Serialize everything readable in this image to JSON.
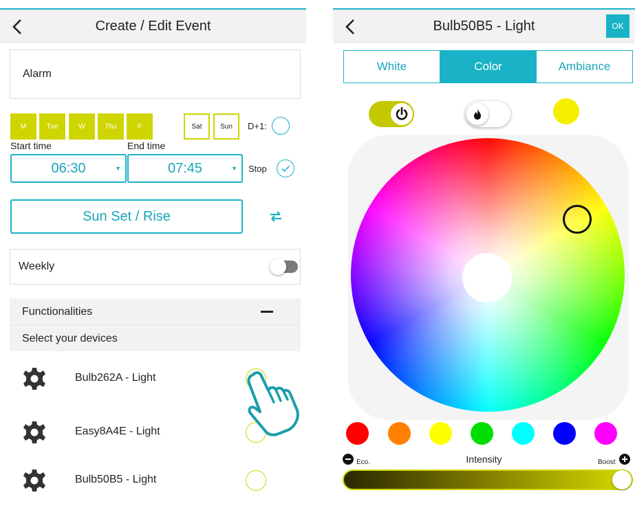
{
  "left": {
    "header": {
      "title": "Create / Edit Event"
    },
    "event_name": "Alarm",
    "days": [
      {
        "label": "M",
        "selected": true
      },
      {
        "label": "Tue",
        "selected": true
      },
      {
        "label": "W",
        "selected": true
      },
      {
        "label": "Thu",
        "selected": true
      },
      {
        "label": "F",
        "selected": true
      },
      {
        "label": "Sat",
        "selected": false
      },
      {
        "label": "Sun",
        "selected": false
      }
    ],
    "d1_label": "D+1:",
    "start_time": {
      "label": "Start time",
      "value": "06:30"
    },
    "end_time": {
      "label": "End time",
      "value": "07:45"
    },
    "stop_label": "Stop",
    "sun_button": "Sun Set / Rise",
    "weekly": {
      "label": "Weekly",
      "on": false
    },
    "functionalities": "Functionalities",
    "select_devices": "Select your devices",
    "devices": [
      {
        "name": "Bulb262A - Light"
      },
      {
        "name": "Easy8A4E - Light"
      },
      {
        "name": "Bulb50B5 - Light"
      }
    ]
  },
  "right": {
    "header": {
      "title": "Bulb50B5 - Light",
      "ok": "OK"
    },
    "tabs": [
      {
        "label": "White",
        "active": false
      },
      {
        "label": "Color",
        "active": true
      },
      {
        "label": "Ambiance",
        "active": false
      }
    ],
    "power_on": true,
    "selected_color": "#f5ee00",
    "swatches": [
      "#ff0000",
      "#ff8000",
      "#ffff00",
      "#00dd00",
      "#00ffff",
      "#0000ff",
      "#ff00ff"
    ],
    "intensity": {
      "label": "Intensity",
      "eco": "Eco.",
      "boost": "Boost",
      "value": 1.0
    }
  },
  "colors": {
    "accent": "#1ab2c6",
    "lime": "#cfd500"
  }
}
